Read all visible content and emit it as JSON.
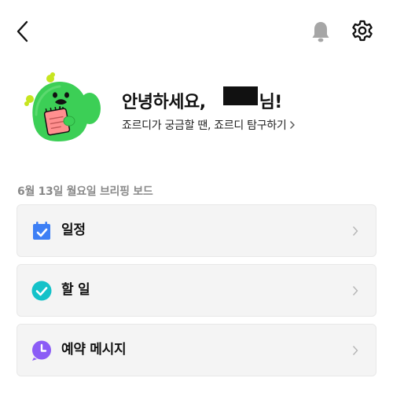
{
  "header": {
    "back": "back-icon",
    "notifications": "bell-icon",
    "settings": "gear-icon"
  },
  "profile": {
    "greeting_prefix": "안녕하세요,",
    "greeting_suffix": "님!",
    "explore_link": "죠르디가 궁금할 땐, 죠르디 탐구하기"
  },
  "briefing": {
    "title": "6월 13일 월요일 브리핑 보드",
    "items": [
      {
        "label": "일정",
        "icon": "calendar-check-icon",
        "color": "#3d7ff5"
      },
      {
        "label": "할 일",
        "icon": "check-circle-icon",
        "color": "#14c2c9"
      },
      {
        "label": "예약 메시지",
        "icon": "clock-icon",
        "color": "#8b5cf6"
      }
    ]
  },
  "colors": {
    "mascot_green": "#3ccf56",
    "divider": "#e8e8e8",
    "card_bg": "#f4f4f4"
  }
}
